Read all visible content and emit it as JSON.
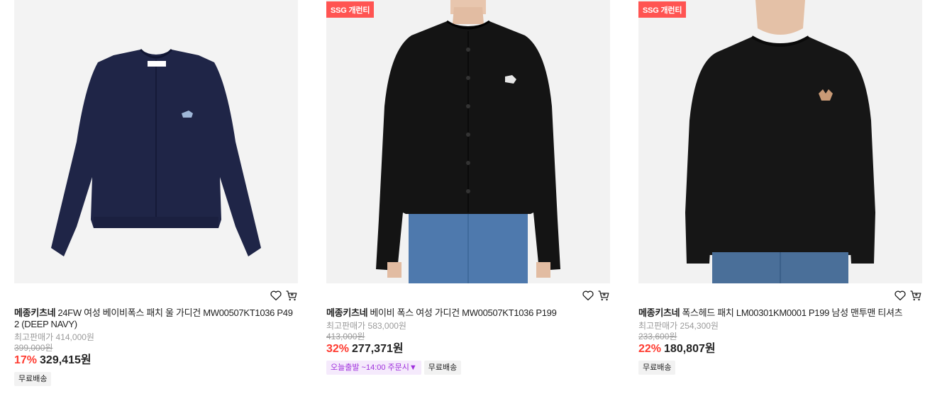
{
  "products": [
    {
      "badge": "",
      "brand": "메종키츠네",
      "name": "24FW 여성 베이비폭스 패치 울 가디건 MW00507KT1036 P49 2 (DEEP NAVY)",
      "ref_price": "최고판매가 414,000원",
      "orig_price": "399,000원",
      "discount": "17%",
      "price": "329,415원",
      "tags": [
        "무료배송"
      ],
      "colors": {
        "garment": "#1f2547"
      }
    },
    {
      "badge": "SSG 개런티",
      "brand": "메종키츠네",
      "name": "베이비 폭스 여성 가디건 MW00507KT1036 P199",
      "ref_price": "최고판매가 583,000원",
      "orig_price": "413,000원",
      "discount": "32%",
      "price": "277,371원",
      "delivery_tag": "오늘출발 ~14:00 주문시▼",
      "tags": [
        "무료배송"
      ],
      "colors": {
        "garment": "#141414",
        "jeans": "#4e79ad"
      }
    },
    {
      "badge": "SSG 개런티",
      "brand": "메종키츠네",
      "name": "폭스헤드 패치 LM00301KM0001 P199 남성 맨투맨 티셔츠",
      "ref_price": "최고판매가 254,300원",
      "orig_price": "233,600원",
      "discount": "22%",
      "price": "180,807원",
      "tags": [
        "무료배송"
      ],
      "colors": {
        "garment": "#161616",
        "jeans": "#4a6f99"
      }
    }
  ],
  "icons": {
    "wish": "heart-icon",
    "cart": "cart-icon"
  }
}
